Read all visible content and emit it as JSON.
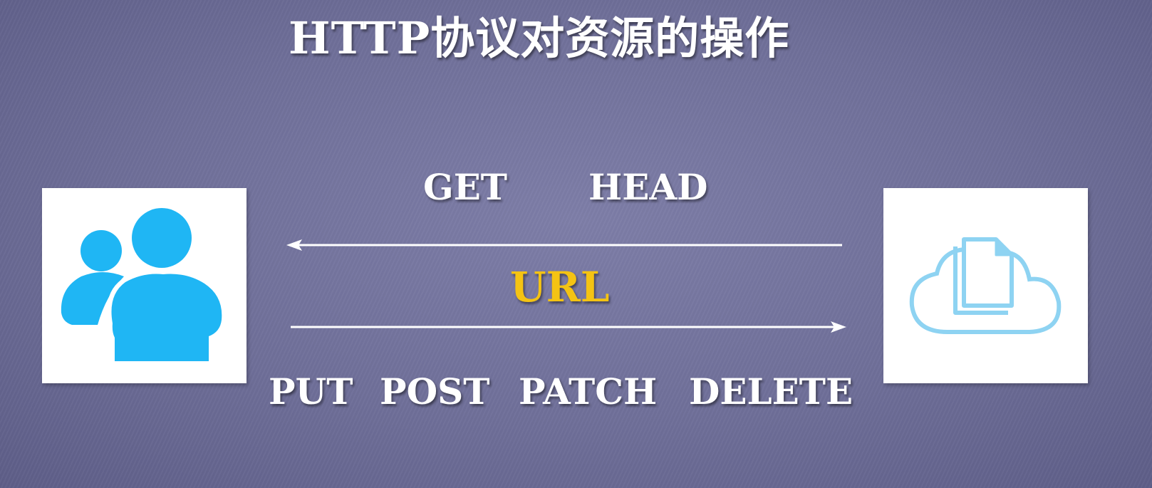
{
  "title": "HTTP协议对资源的操作",
  "read_methods": [
    "GET",
    "HEAD"
  ],
  "center_label": "URL",
  "write_methods": [
    "PUT",
    "POST",
    "PATCH",
    "DELETE"
  ],
  "icons": {
    "client": "users-icon",
    "server": "cloud-documents-icon"
  },
  "colors": {
    "background": "#6f6f99",
    "text": "#ffffff",
    "url": "#f4c313",
    "client_icon": "#1fb6f4",
    "server_icon": "#8ed3f2"
  }
}
